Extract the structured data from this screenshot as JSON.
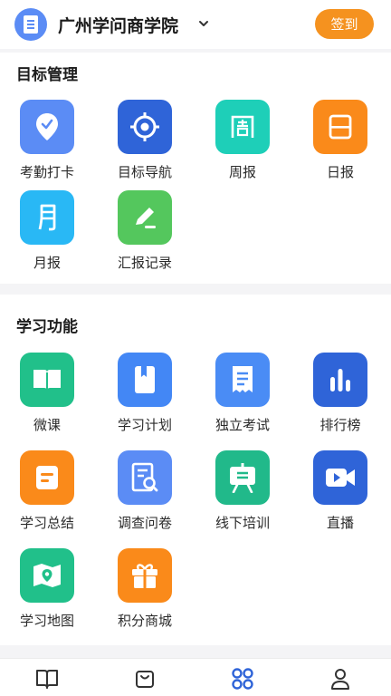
{
  "header": {
    "org_name": "广州学问商学院",
    "checkin_label": "签到"
  },
  "sections": {
    "target": {
      "title": "目标管理",
      "items": [
        {
          "label": "考勤打卡",
          "icon": "location-check-icon",
          "color": "#5b8cf5"
        },
        {
          "label": "目标导航",
          "icon": "target-icon",
          "color": "#2f64d8"
        },
        {
          "label": "周报",
          "icon": "weekly-report-icon",
          "color": "#1ecfb8"
        },
        {
          "label": "日报",
          "icon": "daily-report-icon",
          "color": "#fa8a1a"
        },
        {
          "label": "月报",
          "icon": "monthly-report-icon",
          "color": "#29b8f5"
        },
        {
          "label": "汇报记录",
          "icon": "edit-icon",
          "color": "#54c75d"
        }
      ]
    },
    "study": {
      "title": "学习功能",
      "items": [
        {
          "label": "微课",
          "icon": "book-open-icon",
          "color": "#21c08a"
        },
        {
          "label": "学习计划",
          "icon": "bookmark-book-icon",
          "color": "#4387f5"
        },
        {
          "label": "独立考试",
          "icon": "receipt-icon",
          "color": "#4a8cf5"
        },
        {
          "label": "排行榜",
          "icon": "bar-chart-icon",
          "color": "#2f64d8"
        },
        {
          "label": "学习总结",
          "icon": "document-icon",
          "color": "#fa8a1a"
        },
        {
          "label": "调查问卷",
          "icon": "survey-search-icon",
          "color": "#5b8cf5"
        },
        {
          "label": "线下培训",
          "icon": "easel-icon",
          "color": "#21b98a"
        },
        {
          "label": "直播",
          "icon": "video-camera-icon",
          "color": "#2f64d8"
        },
        {
          "label": "学习地图",
          "icon": "map-pin-icon",
          "color": "#21c08a"
        },
        {
          "label": "积分商城",
          "icon": "gift-icon",
          "color": "#fa8a1a"
        }
      ]
    }
  },
  "tabbar": {
    "tabs": [
      {
        "icon": "book-tab-icon",
        "active": false
      },
      {
        "icon": "bag-tab-icon",
        "active": false
      },
      {
        "icon": "apps-tab-icon",
        "active": true,
        "color": "#2f64d8"
      },
      {
        "icon": "user-tab-icon",
        "active": false
      }
    ]
  }
}
